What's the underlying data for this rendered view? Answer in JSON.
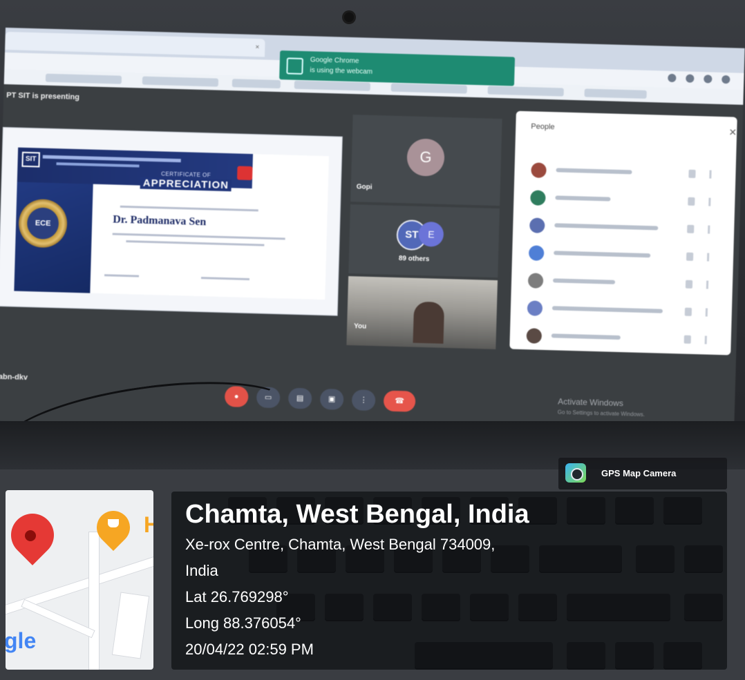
{
  "browser": {
    "toast_title": "Google Chrome",
    "toast_text": "is using the webcam"
  },
  "meet": {
    "presenting_banner": "PT SIT is presenting",
    "meeting_code": "abn-dkv",
    "tiles": [
      {
        "name": "Gopi",
        "avatar_letter": "G"
      },
      {
        "name": "89 others",
        "avatar_letters": [
          "ST",
          "E"
        ]
      },
      {
        "name": "You"
      }
    ],
    "people_panel": {
      "title": "People",
      "close_icon": "close-icon"
    },
    "windows_watermark": "Activate Windows",
    "windows_watermark_sub": "Go to Settings to activate Windows.",
    "certificate": {
      "badge": "SIT",
      "heading_small": "CERTIFICATE OF",
      "heading_main": "APPRECIATION",
      "medal_text": "ECE",
      "recipient": "Dr. Padmanava Sen"
    },
    "colors": {
      "hangup": "#e6554b",
      "mic_off": "#e25248",
      "control": "#4b5466"
    }
  },
  "stamp": {
    "badge_label": "GPS Map Camera",
    "place": "Chamta, West Bengal, India",
    "address_line1": "Xe-rox Centre, Chamta, West Bengal 734009,",
    "address_line2": "India",
    "lat": "Lat 26.769298°",
    "long": "Long 88.376054°",
    "datetime": "20/04/22 02:59 PM",
    "map_poi_letter": "H",
    "map_brand": "gle"
  }
}
